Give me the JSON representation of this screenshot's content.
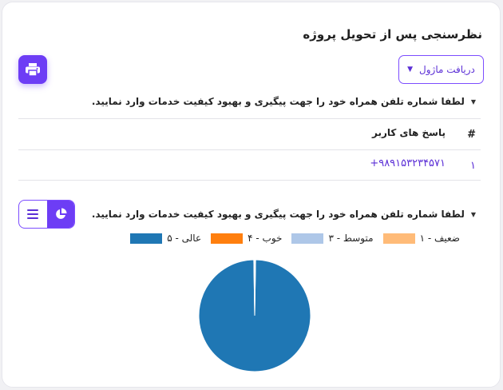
{
  "title": "نظرسنجی پس از تحویل پروژه",
  "module_button": {
    "label": "دریافت ماژول",
    "icon": "caret-down-icon"
  },
  "print_button": {
    "icon": "printer-icon"
  },
  "question1": {
    "text": "لطفا شماره تلفن همراه خود را جهت پیگیری و بهبود کیفیت خدمات وارد نمایید.",
    "table": {
      "headers": [
        "#",
        "پاسخ های کاربر"
      ],
      "rows": [
        {
          "num": "۱",
          "answer": "+۹۸۹۱۵۳۲۳۴۵۷۱"
        }
      ]
    }
  },
  "question2": {
    "text": "لطفا شماره تلفن همراه خود را جهت پیگیری و بهبود کیفیت خدمات وارد نمایید.",
    "view_toggle": {
      "chart_icon": "pie-chart-icon",
      "list_icon": "list-icon",
      "active": "chart"
    }
  },
  "colors": {
    "accent": "#6d3df5",
    "link": "#5b2fd6"
  },
  "chart_data": {
    "type": "pie",
    "legend": [
      {
        "label": "ضعیف - ۱",
        "color": "#ffbb78"
      },
      {
        "label": "متوسط - ۳",
        "color": "#aec7e8"
      },
      {
        "label": "خوب - ۴",
        "color": "#ff7f0e"
      },
      {
        "label": "عالی - ۵",
        "color": "#1f77b4"
      }
    ],
    "slices": [
      {
        "label": "عالی - ۵",
        "value": 99.5,
        "color": "#1f77b4"
      },
      {
        "label": "ضعیف - ۱",
        "value": 0.5,
        "color": "#ffffff"
      }
    ],
    "legend_position": "top"
  }
}
